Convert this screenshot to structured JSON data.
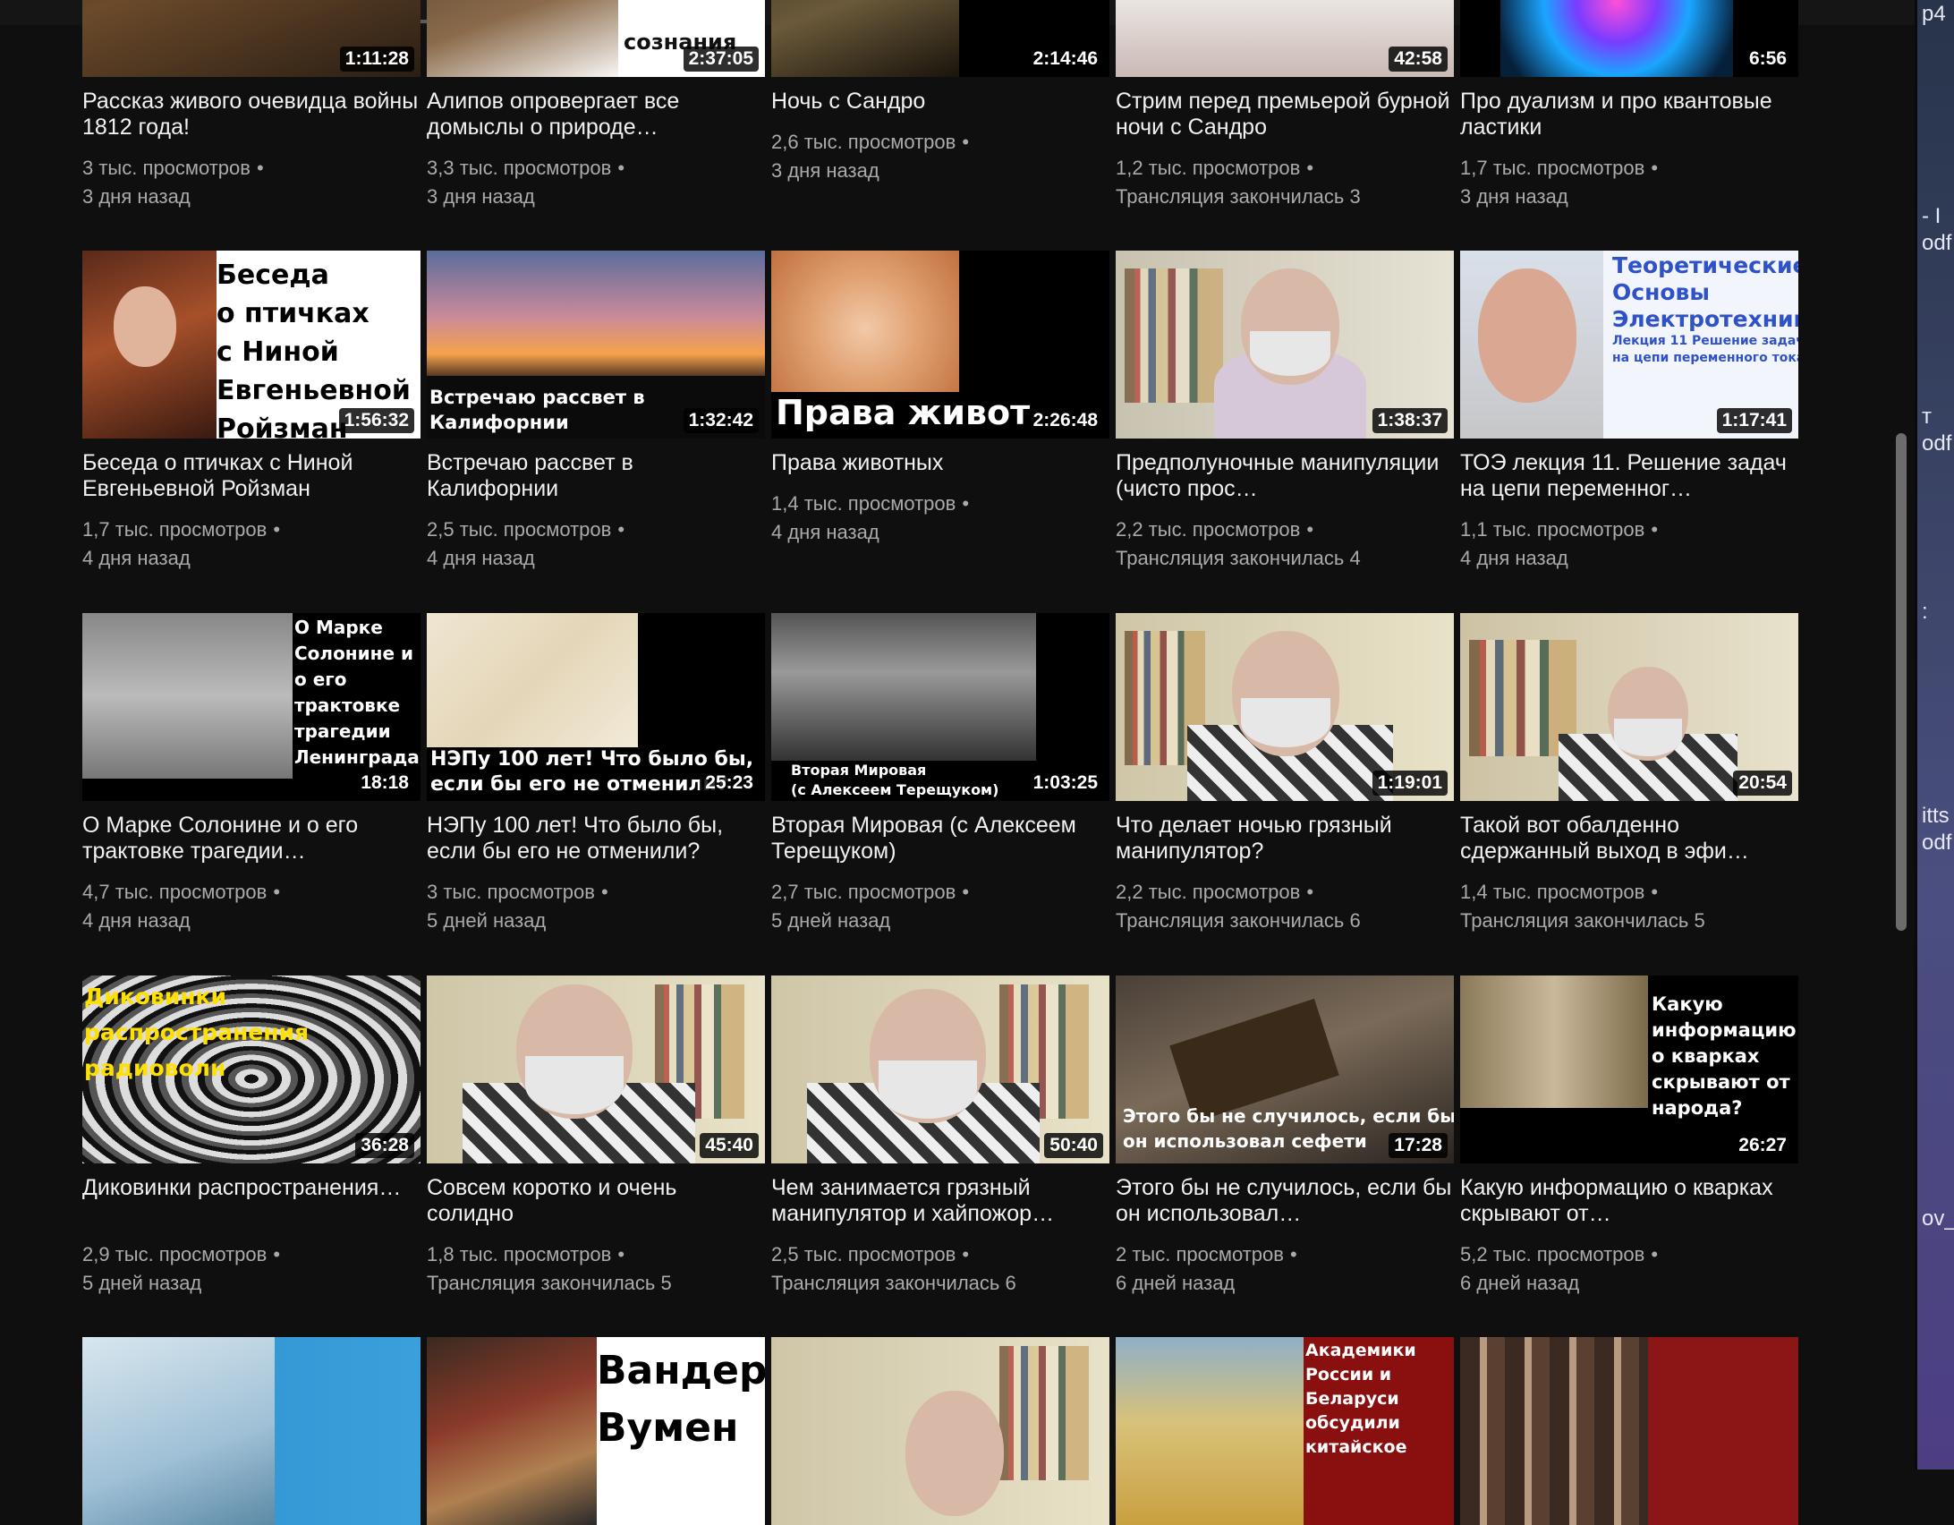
{
  "videos": [
    {
      "title": "Рассказ живого очевидца войны 1812 года!",
      "duration": "1:11:28",
      "views": "3 тыс. просмотров",
      "age": "3 дня назад",
      "thumb_text": ""
    },
    {
      "title": "Алипов опровергает все домыслы о природе…",
      "duration": "2:37:05",
      "views": "3,3 тыс. просмотров",
      "age": "3 дня назад",
      "thumb_text": "сознания"
    },
    {
      "title": "Ночь с Сандро",
      "duration": "2:14:46",
      "views": "2,6 тыс. просмотров",
      "age": "3 дня назад",
      "thumb_text": ""
    },
    {
      "title": "Стрим перед премьерой бурной ночи с Сандро",
      "duration": "42:58",
      "views": "1,2 тыс. просмотров",
      "age": "Трансляция закончилась 3",
      "thumb_text": ""
    },
    {
      "title": "Про дуализм и про квантовые ластики",
      "duration": "6:56",
      "views": "1,7 тыс. просмотров",
      "age": "3 дня назад",
      "thumb_text": ""
    },
    {
      "title": "Беседа о птичках с Ниной Евгеньевной Ройзман",
      "duration": "1:56:32",
      "views": "1,7 тыс. просмотров",
      "age": "4 дня назад",
      "thumb_text": "Беседа\nо птичках\nс Ниной\nЕвгеньевной\nРойзман"
    },
    {
      "title": "Встречаю рассвет в Калифорнии",
      "duration": "1:32:42",
      "views": "2,5 тыс. просмотров",
      "age": "4 дня назад",
      "thumb_text": "Встречаю рассвет в\nКалифорнии"
    },
    {
      "title": "Права животных",
      "duration": "2:26:48",
      "views": "1,4 тыс. просмотров",
      "age": "4 дня назад",
      "thumb_text": "Права живот"
    },
    {
      "title": "Предполуночные манипуляции (чисто прос…",
      "duration": "1:38:37",
      "views": "2,2 тыс. просмотров",
      "age": "Трансляция закончилась 4",
      "thumb_text": ""
    },
    {
      "title": "ТОЭ лекция 11. Решение задач на цепи переменног…",
      "duration": "1:17:41",
      "views": "1,1 тыс. просмотров",
      "age": "4 дня назад",
      "thumb_text": "Теоретические\nОсновы\nЭлектротехники",
      "thumb_sub": "Лекция 11 Решение задач\nна цепи переменного тока"
    },
    {
      "title": "О Марке Солонине и о его трактовке трагедии…",
      "duration": "18:18",
      "views": "4,7 тыс. просмотров",
      "age": "4 дня назад",
      "thumb_text": "О Марке\nСолонине и\nо его\nтрактовке\nтрагедии\nЛенинграда"
    },
    {
      "title": "НЭПу 100 лет! Что было бы, если бы его не отменили?",
      "duration": "25:23",
      "views": "3 тыс. просмотров",
      "age": "5 дней назад",
      "thumb_text": "НЭПу 100 лет! Что было бы,\nесли бы его не отменили?"
    },
    {
      "title": "Вторая Мировая (с Алексеем Терещуком)",
      "duration": "1:03:25",
      "views": "2,7 тыс. просмотров",
      "age": "5 дней назад",
      "thumb_text": "Вторая Мировая\n(с Алексеем Терещуком)"
    },
    {
      "title": "Что делает ночью грязный манипулятор?",
      "duration": "1:19:01",
      "views": "2,2 тыс. просмотров",
      "age": "Трансляция закончилась 6",
      "thumb_text": ""
    },
    {
      "title": "Такой вот обалденно сдержанный выход в эфи…",
      "duration": "20:54",
      "views": "1,4 тыс. просмотров",
      "age": "Трансляция закончилась 5",
      "thumb_text": ""
    },
    {
      "title": "Диковинки распространения…",
      "duration": "36:28",
      "views": "2,9 тыс. просмотров",
      "age": "5 дней назад",
      "thumb_text": "Диковинки\nраспространения\nрадиоволн"
    },
    {
      "title": "Совсем коротко и очень солидно",
      "duration": "45:40",
      "views": "1,8 тыс. просмотров",
      "age": "Трансляция закончилась 5",
      "thumb_text": ""
    },
    {
      "title": "Чем занимается грязный манипулятор и хайпожор…",
      "duration": "50:40",
      "views": "2,5 тыс. просмотров",
      "age": "Трансляция закончилась 6",
      "thumb_text": ""
    },
    {
      "title": "Этого бы не случилось, если бы он использовал…",
      "duration": "17:28",
      "views": "2 тыс. просмотров",
      "age": "6 дней назад",
      "thumb_text": "Этого бы не случилось, если бы\nон использовал сефети"
    },
    {
      "title": "Какую информацию о кварках скрывают от…",
      "duration": "26:27",
      "views": "5,2 тыс. просмотров",
      "age": "6 дней назад",
      "thumb_text": "Какую\nинформацию\nо кварках\nскрывают от\nнарода?"
    },
    {
      "thumb_text": ""
    },
    {
      "thumb_text": "Вандер\nВумен"
    },
    {
      "thumb_text": ""
    },
    {
      "thumb_text": "Академики\nРоссии и\nБеларуси\nобсудили\nкитайское"
    },
    {
      "thumb_text": ""
    }
  ],
  "right_strip": [
    "p4",
    "- I",
    "odf",
    "т",
    "odf",
    ":",
    "itts",
    "odf",
    "ov_"
  ],
  "colors": {
    "background": "#0f0f0f",
    "title": "#f1f1f1",
    "meta": "#aaaaaa",
    "duration_bg": "#000000"
  }
}
